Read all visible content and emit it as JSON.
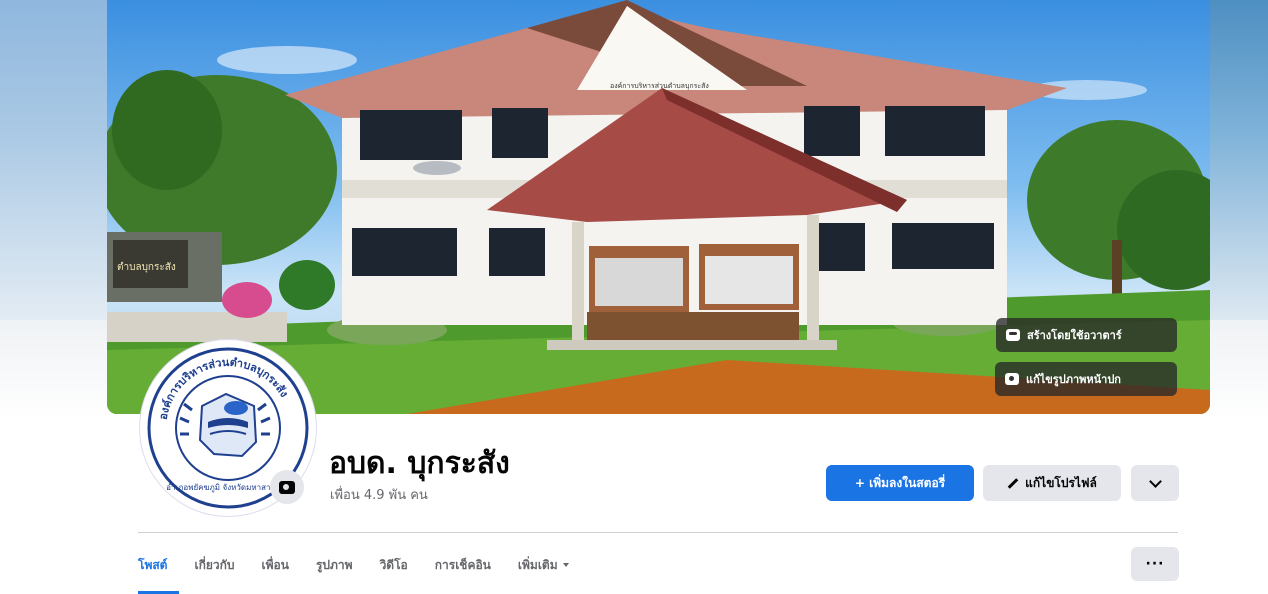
{
  "page": {
    "name": "อบด. บุกระสัง",
    "followers": "เพื่อน 4.9 พัน คน"
  },
  "cover": {
    "create_avatar_label": "สร้างโดยใช้อวาตาร์",
    "edit_cover_label": "แก้ไขรูปภาพหน้าปก",
    "building_sign": "องค์การบริหารส่วนตำบลบุกระสัง",
    "gate_sign": "ตำบลบุกระสัง"
  },
  "avatar": {
    "ring_text": "องค์การบริหารส่วนตำบลบุกระสัง",
    "bottom_text": "อำเภอพยัคฆภูมิ จังหวัดมหาสารคาม"
  },
  "actions": {
    "add_story": "+ เพิ่มลงในสตอรี่",
    "edit_profile": "แก้ไขโปรไฟล์",
    "more_icon": "chevron-down-icon"
  },
  "tabs": [
    {
      "label": "โพสต์"
    },
    {
      "label": "เกี่ยวกับ"
    },
    {
      "label": "เพื่อน"
    },
    {
      "label": "รูปภาพ"
    },
    {
      "label": "วิดีโอ"
    },
    {
      "label": "การเช็คอิน"
    },
    {
      "label": "เพิ่มเติม"
    }
  ],
  "more_menu": "···",
  "colors": {
    "accent": "#1b74e4",
    "secondary_button": "#e4e6eb",
    "muted_text": "#65676b"
  }
}
